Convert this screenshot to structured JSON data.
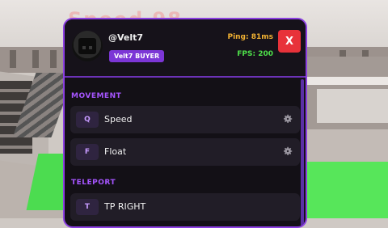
{
  "background": {
    "title": "Speed 98"
  },
  "header": {
    "username": "@Velt7",
    "badge": "Velt7 BUYER",
    "ping": "Ping: 81ms",
    "fps": "FPS: 200",
    "close_label": "X",
    "avatar_icon": "avatar-icon",
    "colors": {
      "accent": "#8b3fe0",
      "ping": "#f2b233",
      "fps": "#4ee04a",
      "close": "#e8323a"
    }
  },
  "sections": {
    "movement": {
      "label": "MOVEMENT",
      "items": [
        {
          "key": "Q",
          "label": "Speed",
          "icon": "gear-icon"
        },
        {
          "key": "F",
          "label": "Float",
          "icon": "gear-icon"
        }
      ]
    },
    "teleport": {
      "label": "TELEPORT",
      "items": [
        {
          "key": "T",
          "label": "TP RIGHT"
        }
      ]
    }
  }
}
